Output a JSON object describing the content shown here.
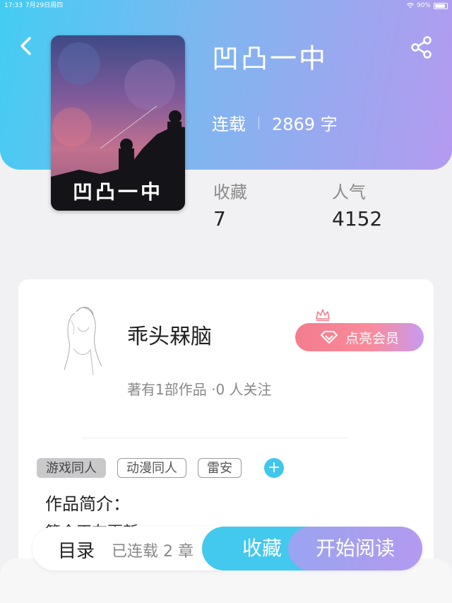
{
  "status_bar": {
    "time": "17:33",
    "date": "7月29日周四",
    "battery": "90%",
    "battery_level": 0.9
  },
  "header": {
    "back_icon": "back-arrow-icon",
    "share_icon": "share-icon",
    "gradient": [
      "#43cdf2",
      "#b49af0"
    ]
  },
  "book": {
    "cover_title": "凹凸一中",
    "title": "凹凸一中",
    "status": "连载",
    "word_count": "2869 字"
  },
  "stats": {
    "favorites_label": "收藏",
    "favorites_value": "7",
    "popularity_label": "人气",
    "popularity_value": "4152"
  },
  "author": {
    "name": "乖头槑脑",
    "summary": "著有1部作品 ·0 人关注",
    "vip_label": "点亮会员"
  },
  "tags": [
    "游戏同人",
    "动漫同人",
    "雷安"
  ],
  "intro": {
    "title": "作品简介：",
    "text": "简介正在更新"
  },
  "bottom_bar": {
    "toc_label": "目录",
    "serial_info": "已连载 2 章",
    "collect_label": "收藏",
    "read_label": "开始阅读"
  },
  "colors": {
    "accent_blue": "#43c8ee",
    "accent_purple": "#b39af0",
    "vip_pink": "#f47c8d"
  }
}
